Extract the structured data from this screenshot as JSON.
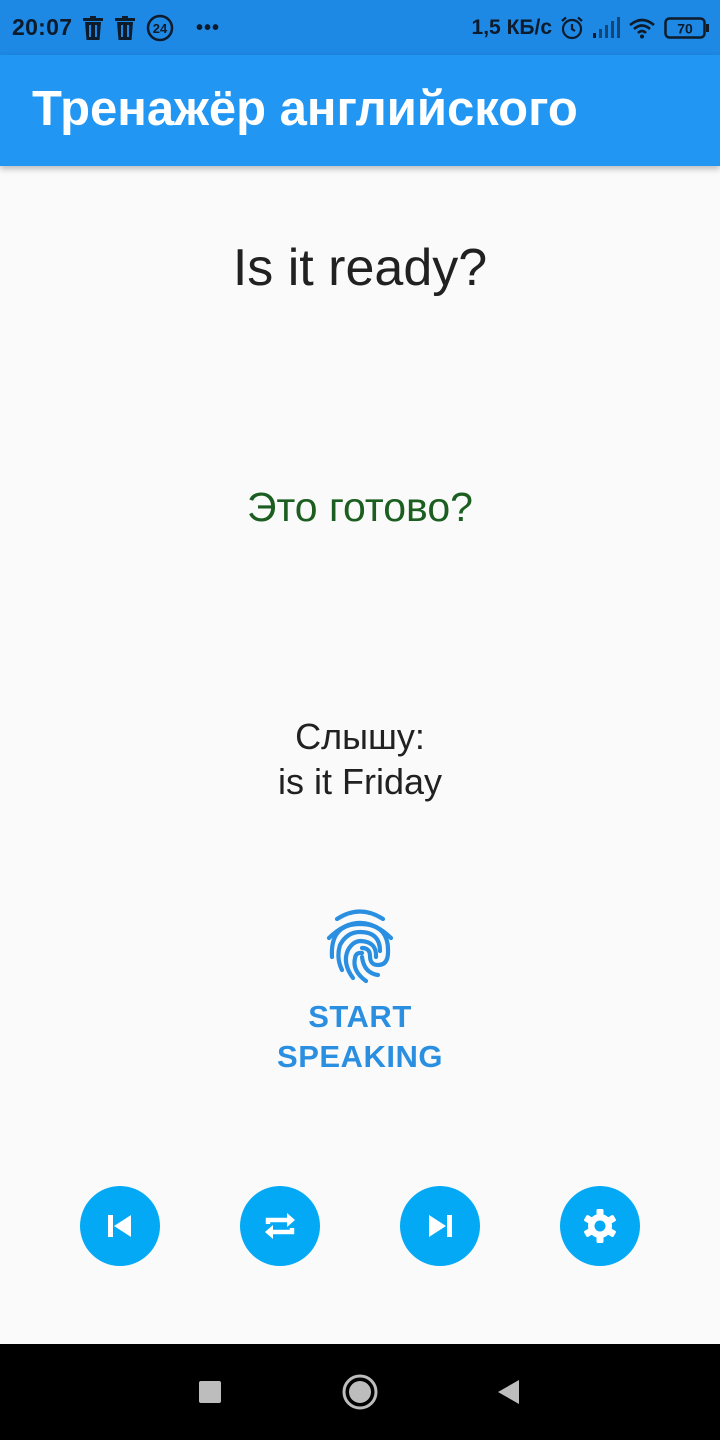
{
  "status_bar": {
    "time": "20:07",
    "notification_badge": "24",
    "more": "•••",
    "speed": "1,5 КБ/с",
    "battery": "70",
    "icons": [
      "trash-icon",
      "trash-icon",
      "badge-24-icon",
      "more-dots-icon",
      "alarm-icon",
      "signal-icon",
      "wifi-icon",
      "battery-icon"
    ]
  },
  "app_bar": {
    "title": "Тренажёр английского",
    "color": "#2196f3"
  },
  "main": {
    "english_phrase": "Is it ready?",
    "russian_translation": "Это готово?",
    "heard_label": "Слышу:",
    "heard_text": "is it Friday",
    "speak_button_line1": "START",
    "speak_button_line2": "SPEAKING",
    "speak_icon": "fingerprint-icon",
    "accent_color": "#2a8fe0",
    "translation_color": "#1b5e20"
  },
  "controls": {
    "buttons": [
      {
        "icon": "skip-previous-icon"
      },
      {
        "icon": "repeat-icon"
      },
      {
        "icon": "skip-next-icon"
      },
      {
        "icon": "settings-gear-icon"
      }
    ],
    "button_color": "#03a9f4"
  },
  "nav_bar": {
    "buttons": [
      "recents-square-icon",
      "home-circle-icon",
      "back-triangle-icon"
    ]
  }
}
